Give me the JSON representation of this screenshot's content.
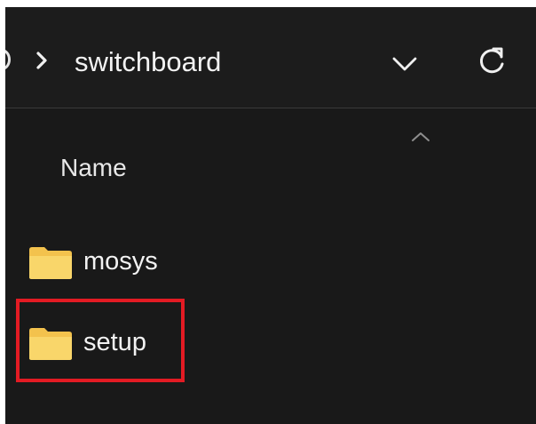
{
  "breadcrumb": {
    "current_folder": "switchboard",
    "separator_icon": "chevron-right-icon",
    "dropdown_icon": "chevron-down-icon",
    "refresh_icon": "refresh-icon"
  },
  "file_list": {
    "column_header": "Name",
    "sort_icon": "sort-up-chevron-icon",
    "items": [
      {
        "label": "mosys",
        "type": "folder",
        "highlighted": false
      },
      {
        "label": "setup",
        "type": "folder",
        "highlighted": true
      }
    ]
  },
  "colors": {
    "background": "#191919",
    "text": "#f2f2f2",
    "folder_yellow": "#f4c84e",
    "highlight_red": "#e31b23"
  }
}
